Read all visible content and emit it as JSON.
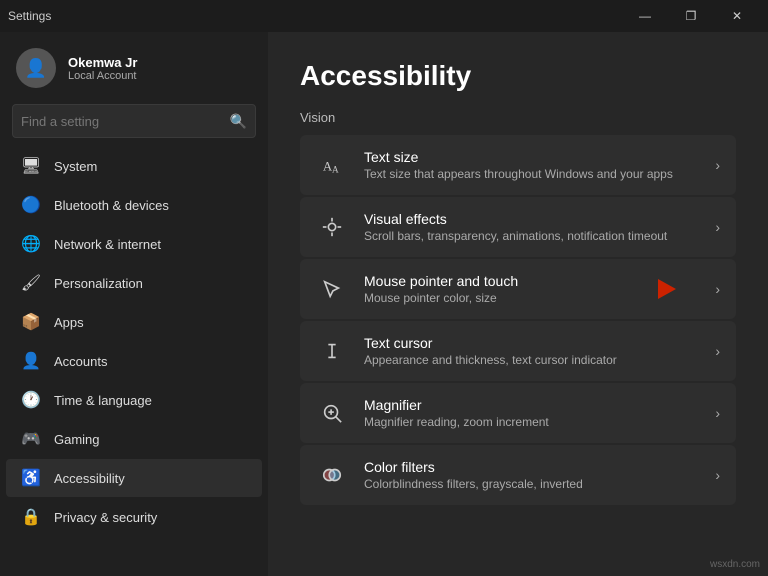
{
  "titlebar": {
    "title": "Settings",
    "minimize": "—",
    "maximize": "❐",
    "close": "✕"
  },
  "sidebar": {
    "user": {
      "name": "Okemwa Jr",
      "subtitle": "Local Account"
    },
    "search": {
      "placeholder": "Find a setting"
    },
    "nav": [
      {
        "id": "system",
        "label": "System",
        "icon": "🖥"
      },
      {
        "id": "bluetooth",
        "label": "Bluetooth & devices",
        "icon": "🔵"
      },
      {
        "id": "network",
        "label": "Network & internet",
        "icon": "🌐"
      },
      {
        "id": "personalization",
        "label": "Personalization",
        "icon": "🖌"
      },
      {
        "id": "apps",
        "label": "Apps",
        "icon": "📦"
      },
      {
        "id": "accounts",
        "label": "Accounts",
        "icon": "👤"
      },
      {
        "id": "time",
        "label": "Time & language",
        "icon": "🕐"
      },
      {
        "id": "gaming",
        "label": "Gaming",
        "icon": "🎮"
      },
      {
        "id": "accessibility",
        "label": "Accessibility",
        "icon": "♿"
      },
      {
        "id": "privacy",
        "label": "Privacy & security",
        "icon": "🔒"
      }
    ]
  },
  "content": {
    "page_title": "Accessibility",
    "section_title": "Vision",
    "items": [
      {
        "id": "text-size",
        "title": "Text size",
        "subtitle": "Text size that appears throughout Windows and your apps",
        "icon": "A",
        "has_arrow": false
      },
      {
        "id": "visual-effects",
        "title": "Visual effects",
        "subtitle": "Scroll bars, transparency, animations, notification timeout",
        "icon": "✦",
        "has_arrow": false
      },
      {
        "id": "mouse-pointer",
        "title": "Mouse pointer and touch",
        "subtitle": "Mouse pointer color, size",
        "icon": "⬆",
        "has_arrow": true
      },
      {
        "id": "text-cursor",
        "title": "Text cursor",
        "subtitle": "Appearance and thickness, text cursor indicator",
        "icon": "Ib",
        "has_arrow": false
      },
      {
        "id": "magnifier",
        "title": "Magnifier",
        "subtitle": "Magnifier reading, zoom increment",
        "icon": "🔍",
        "has_arrow": false
      },
      {
        "id": "color-filters",
        "title": "Color filters",
        "subtitle": "Colorblindness filters, grayscale, inverted",
        "icon": "🎨",
        "has_arrow": false
      }
    ]
  },
  "watermark": "wsxdn.com"
}
